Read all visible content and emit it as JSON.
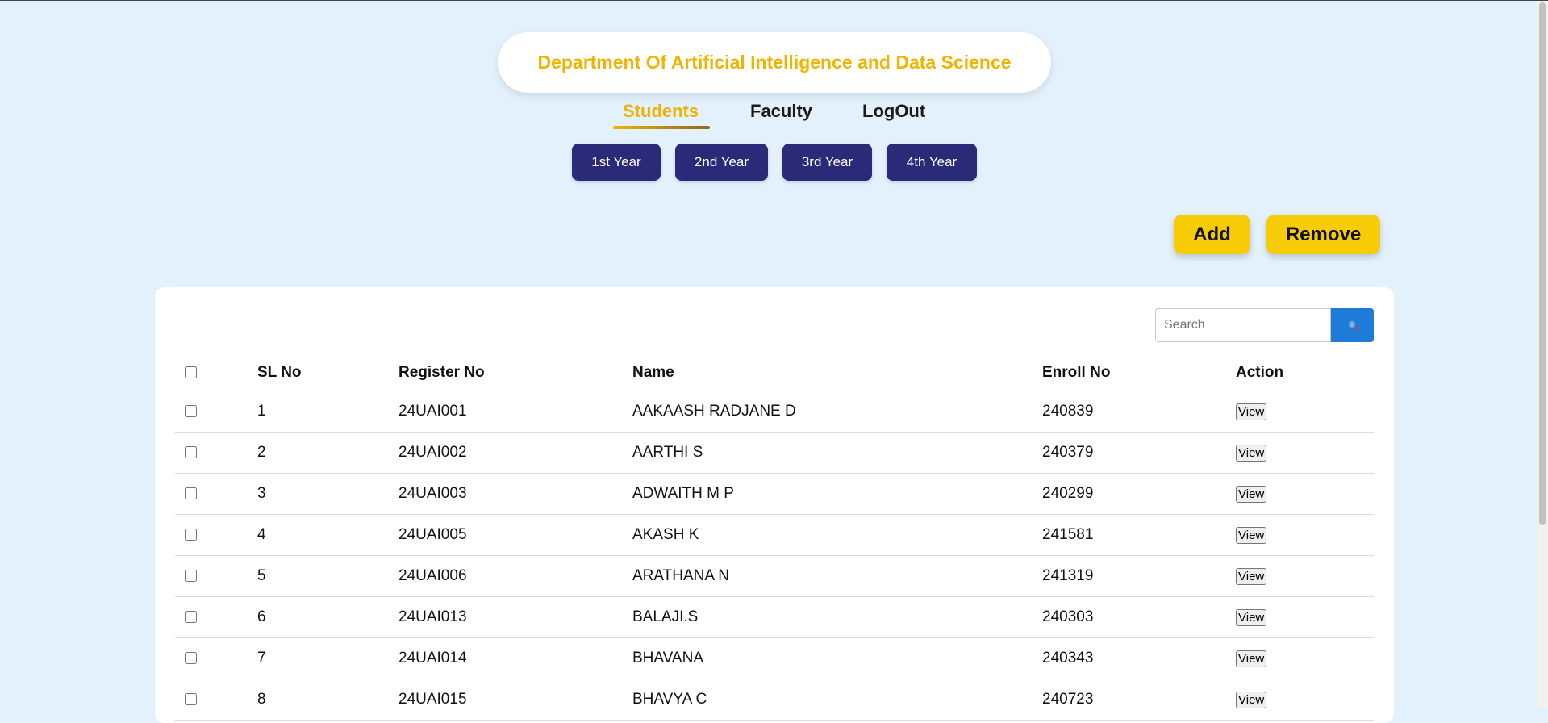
{
  "header": {
    "title": "Department Of Artificial Intelligence and Data Science"
  },
  "nav": {
    "items": [
      {
        "label": "Students",
        "active": true
      },
      {
        "label": "Faculty",
        "active": false
      },
      {
        "label": "LogOut",
        "active": false
      }
    ]
  },
  "years": [
    "1st Year",
    "2nd Year",
    "3rd Year",
    "4th Year"
  ],
  "actions": {
    "add_label": "Add",
    "remove_label": "Remove"
  },
  "search": {
    "placeholder": "Search",
    "icon": "search-icon"
  },
  "table": {
    "columns": [
      "SL No",
      "Register No",
      "Name",
      "Enroll No",
      "Action"
    ],
    "view_label": "View",
    "rows": [
      {
        "sl": "1",
        "reg": "24UAI001",
        "name": "AAKAASH RADJANE D",
        "enroll": "240839"
      },
      {
        "sl": "2",
        "reg": "24UAI002",
        "name": "AARTHI S",
        "enroll": "240379"
      },
      {
        "sl": "3",
        "reg": "24UAI003",
        "name": "ADWAITH M P",
        "enroll": "240299"
      },
      {
        "sl": "4",
        "reg": "24UAI005",
        "name": "AKASH K",
        "enroll": "241581"
      },
      {
        "sl": "5",
        "reg": "24UAI006",
        "name": "ARATHANA N",
        "enroll": "241319"
      },
      {
        "sl": "6",
        "reg": "24UAI013",
        "name": "BALAJI.S",
        "enroll": "240303"
      },
      {
        "sl": "7",
        "reg": "24UAI014",
        "name": "BHAVANA",
        "enroll": "240343"
      },
      {
        "sl": "8",
        "reg": "24UAI015",
        "name": "BHAVYA C",
        "enroll": "240723"
      }
    ]
  },
  "colors": {
    "background": "#e3f1fc",
    "accent_yellow": "#f0b400",
    "year_button": "#2a2a78",
    "action_button": "#f8cc05",
    "search_button": "#1e7bd8"
  }
}
